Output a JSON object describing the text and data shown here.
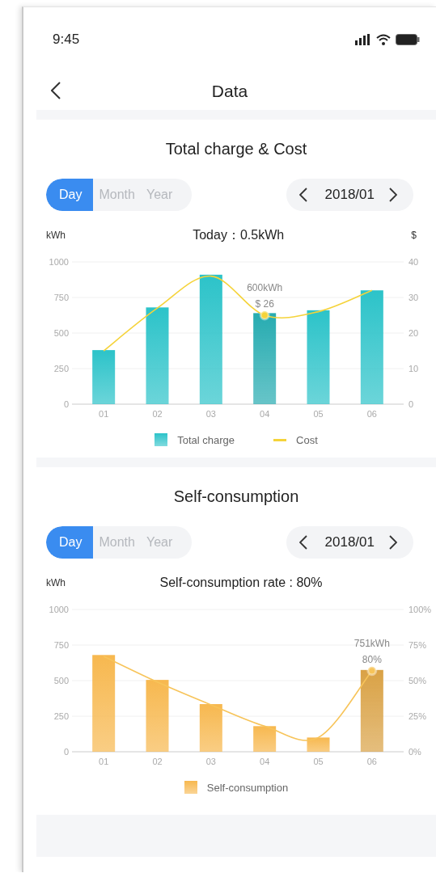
{
  "status_bar": {
    "time": "9:45"
  },
  "nav": {
    "title": "Data"
  },
  "sections": [
    {
      "title": "Total charge & Cost",
      "tabs": [
        {
          "label": "Day",
          "selected": true
        },
        {
          "label": "Month",
          "selected": false
        },
        {
          "label": "Year",
          "selected": false
        }
      ],
      "date": "2018/01",
      "summary": "Today：0.5kWh",
      "chart_data": {
        "type": "bar",
        "categories": [
          "01",
          "02",
          "03",
          "04",
          "05",
          "06"
        ],
        "ylabel": "kWh",
        "y2label": "$",
        "ylim": [
          0,
          1000
        ],
        "yticks": [
          0,
          250,
          500,
          750,
          1000
        ],
        "y2lim": [
          0,
          40
        ],
        "y2ticks": [
          0,
          10,
          20,
          30,
          40
        ],
        "series": [
          {
            "name": "Total charge",
            "color": "#2cc3c9",
            "values": [
              380,
              680,
              910,
              640,
              660,
              800
            ]
          },
          {
            "name": "Cost",
            "type": "line",
            "color": "#f5d33a",
            "axis": "y2",
            "values": [
              15,
              27,
              36,
              25,
              26,
              32
            ]
          }
        ],
        "grid": true,
        "annotations": [
          "600kWh",
          "$ 26"
        ]
      },
      "bars_selected": [
        false,
        false,
        false,
        true,
        false,
        false
      ]
    },
    {
      "title": "Self-consumption",
      "tabs": [
        {
          "label": "Day",
          "selected": true
        },
        {
          "label": "Month",
          "selected": false
        },
        {
          "label": "Year",
          "selected": false
        }
      ],
      "date": "2018/01",
      "summary": "Self-consumption rate : 80%",
      "chart_data": {
        "type": "bar",
        "categories": [
          "01",
          "02",
          "03",
          "04",
          "05",
          "06"
        ],
        "ylabel": "kWh",
        "ylim": [
          0,
          1000
        ],
        "yticks": [
          0,
          250,
          500,
          750,
          1000
        ],
        "y2lim": [
          0,
          100
        ],
        "y2ticks": [
          {
            "value": 0,
            "label": "0%"
          },
          {
            "value": 25,
            "label": "25%"
          },
          {
            "value": 50,
            "label": "50%"
          },
          {
            "value": 75,
            "label": "75%"
          },
          {
            "value": 100,
            "label": "100%"
          }
        ],
        "series": [
          {
            "name": "Self-consumption",
            "color": "#f7b84f",
            "values": [
              680,
              505,
              335,
              180,
              100,
              575
            ]
          },
          {
            "type": "line",
            "color": "#f7c45a",
            "axis": "y2",
            "values": [
              67,
              49,
              33,
              18,
              10,
              57
            ]
          }
        ],
        "grid": true,
        "annotations": [
          "751kWh",
          "80%"
        ]
      },
      "bars_selected": [
        false,
        false,
        false,
        false,
        false,
        true
      ]
    }
  ]
}
